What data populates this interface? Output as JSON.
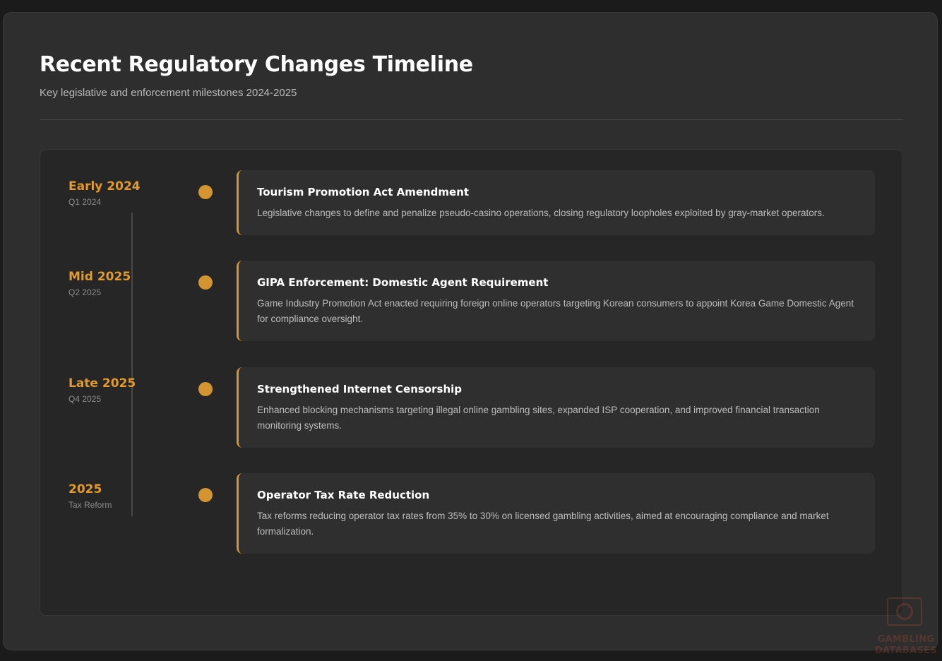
{
  "header": {
    "title": "Recent Regulatory Changes Timeline",
    "subtitle": "Key legislative and enforcement milestones 2024-2025"
  },
  "timeline": [
    {
      "date": "Early 2024",
      "period": "Q1 2024",
      "title": "Tourism Promotion Act Amendment",
      "description": "Legislative changes to define and penalize pseudo-casino operations, closing regulatory loopholes exploited by gray-market operators."
    },
    {
      "date": "Mid 2025",
      "period": "Q2 2025",
      "title": "GIPA Enforcement: Domestic Agent Requirement",
      "description": "Game Industry Promotion Act enacted requiring foreign online operators targeting Korean consumers to appoint Korea Game Domestic Agent for compliance oversight."
    },
    {
      "date": "Late 2025",
      "period": "Q4 2025",
      "title": "Strengthened Internet Censorship",
      "description": "Enhanced blocking mechanisms targeting illegal online gambling sites, expanded ISP cooperation, and improved financial transaction monitoring systems."
    },
    {
      "date": "2025",
      "period": "Tax Reform",
      "title": "Operator Tax Rate Reduction",
      "description": "Tax reforms reducing operator tax rates from 35% to 30% on licensed gambling activities, aimed at encouraging compliance and market formalization."
    }
  ],
  "watermark": {
    "line1": "GAMBLING",
    "line2": "DATABASES"
  },
  "colors": {
    "accent": "#d49430",
    "date_text": "#e39a2c",
    "background": "#2e2e2e",
    "card": "#2f2f2f"
  }
}
